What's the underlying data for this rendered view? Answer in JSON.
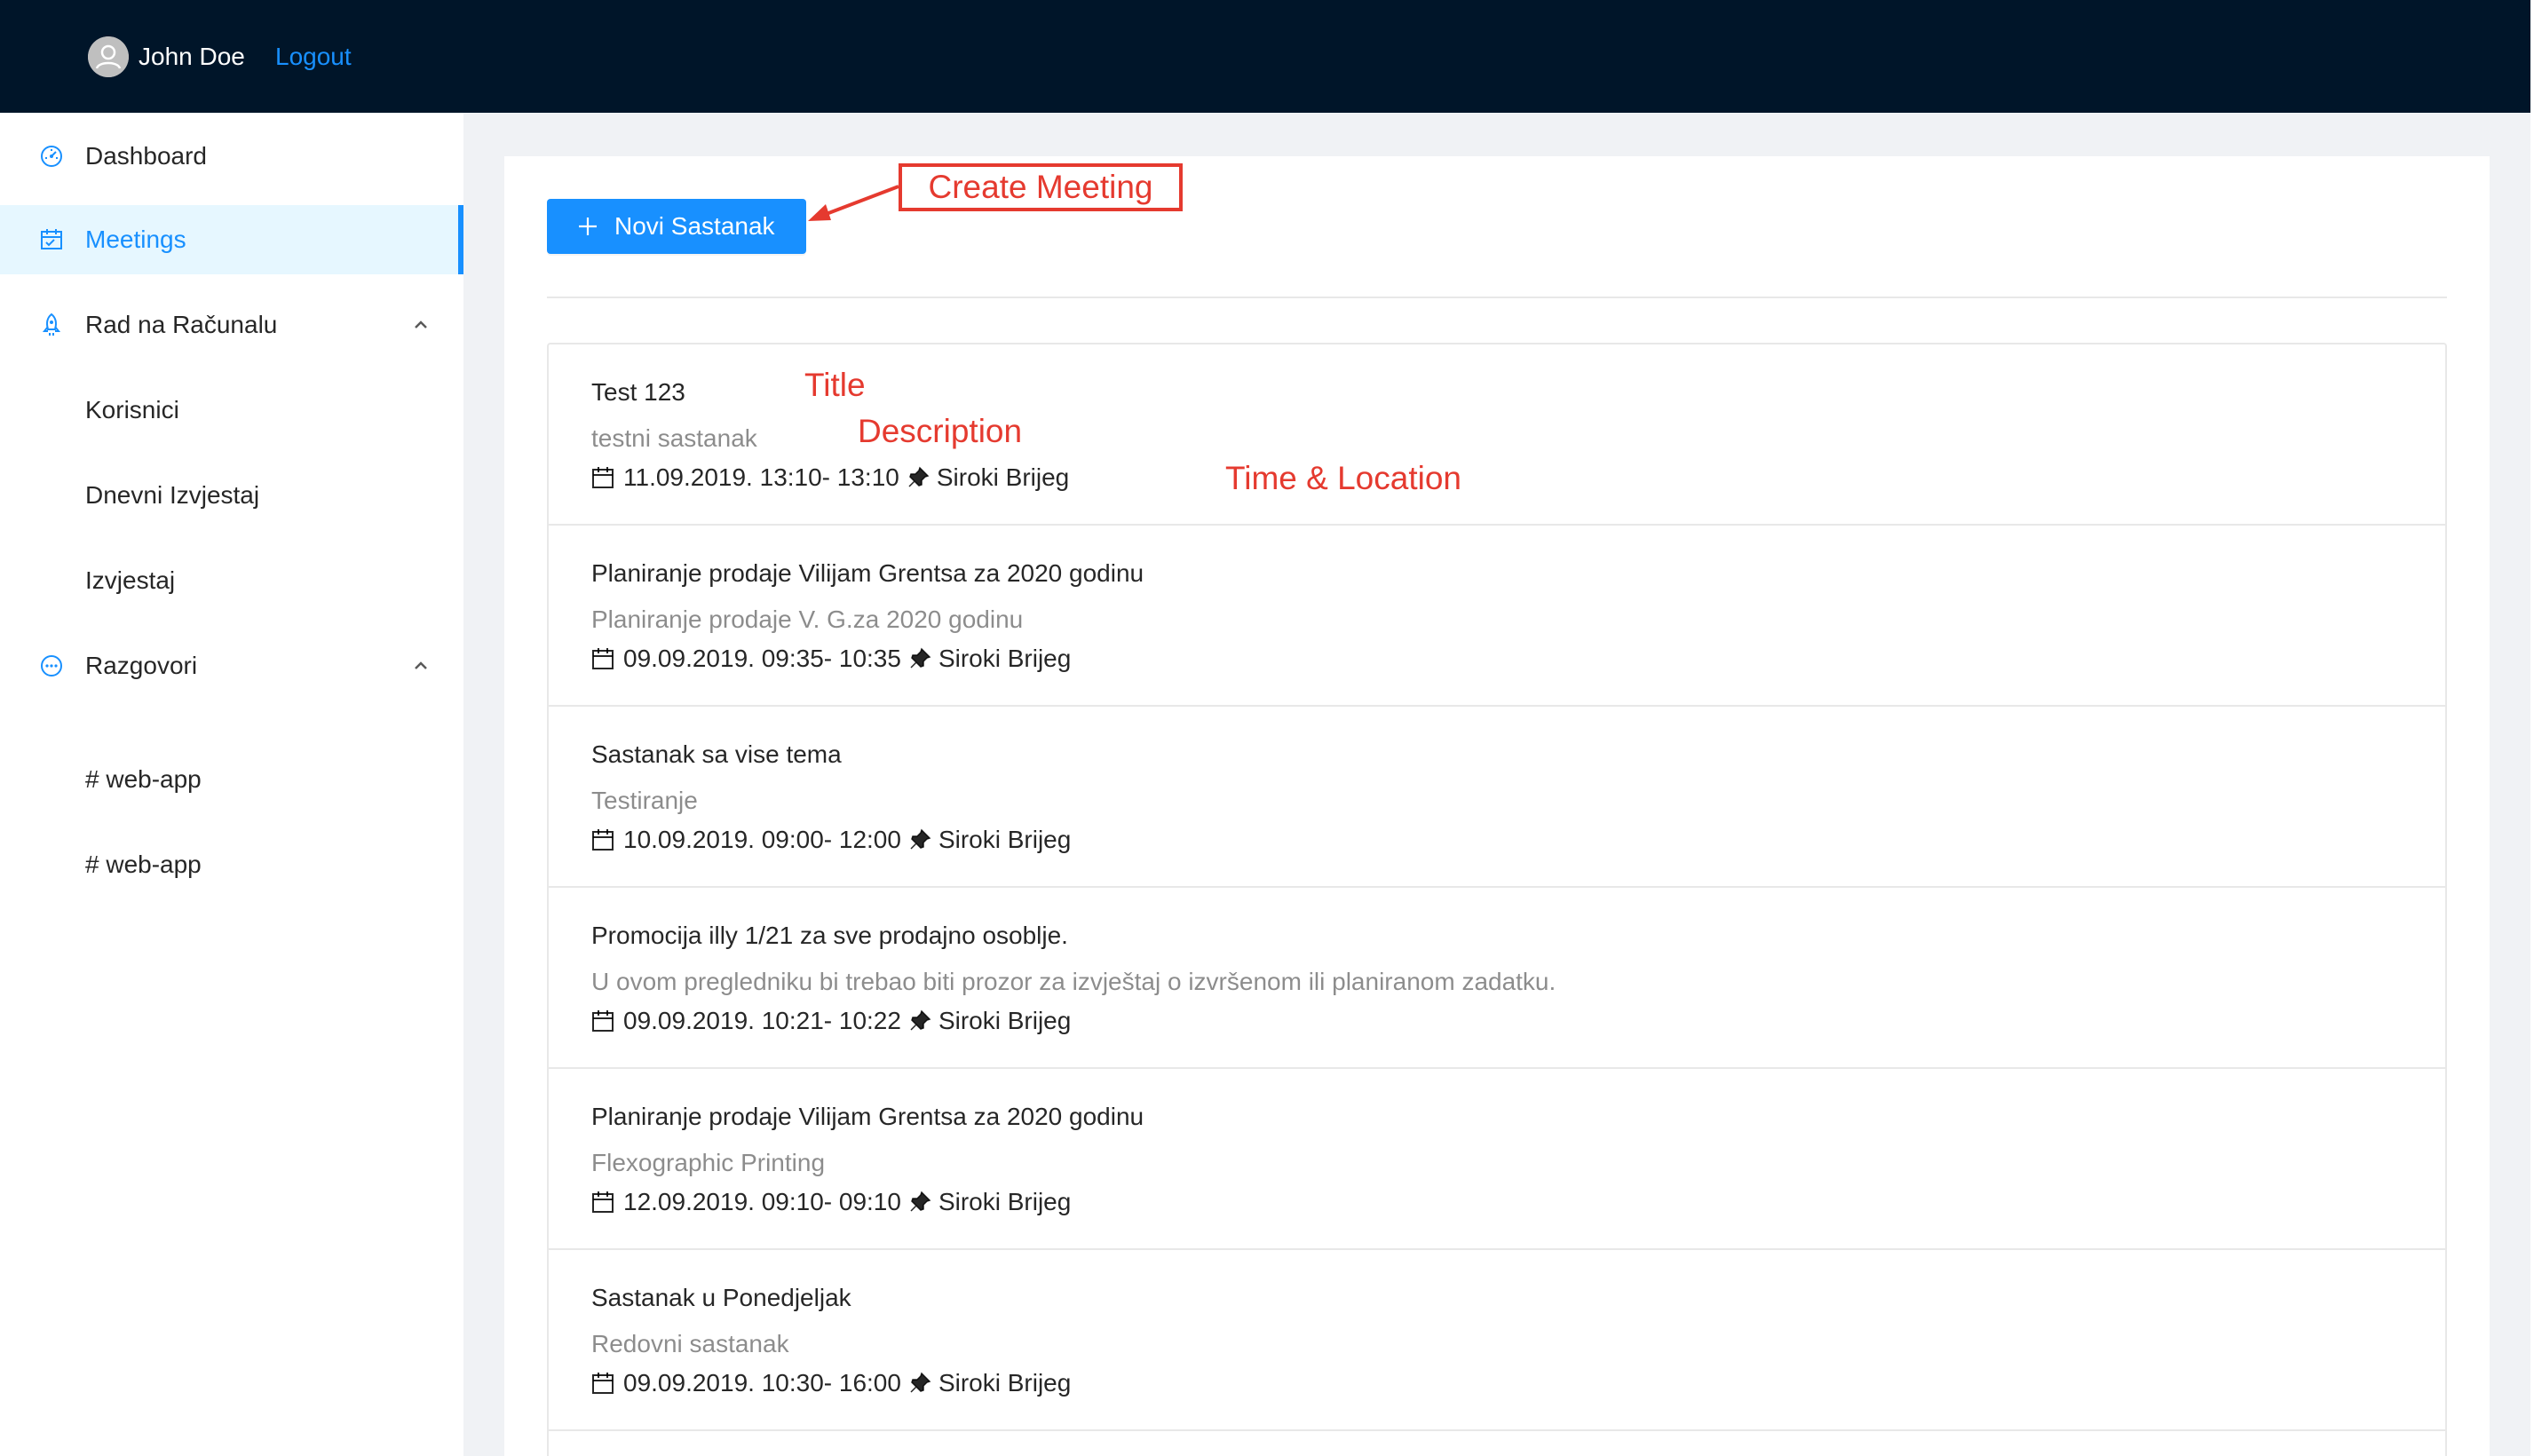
{
  "header": {
    "user_name": "John Doe",
    "logout_label": "Logout",
    "background": "#001529",
    "link_color": "#1890ff"
  },
  "sidebar": {
    "items": [
      {
        "label": "Dashboard",
        "icon": "dashboard-icon"
      },
      {
        "label": "Meetings",
        "icon": "calendar-icon",
        "selected": true
      },
      {
        "label": "Rad na Računalu",
        "icon": "rocket-icon",
        "expanded": true
      },
      {
        "label": "Korisnici"
      },
      {
        "label": "Dnevni Izvjestaj"
      },
      {
        "label": "Izvjestaj"
      },
      {
        "label": "Razgovori",
        "icon": "message-icon",
        "expanded": true
      },
      {
        "label": "# web-app"
      },
      {
        "label": "# web-app"
      }
    ],
    "accent": "#1890ff"
  },
  "toolbar": {
    "new_meeting_label": "Novi Sastanak"
  },
  "meetings": [
    {
      "title": "Test 123",
      "description": "testni sastanak",
      "time": "11.09.2019. 13:10- 13:10",
      "location": "Siroki Brijeg"
    },
    {
      "title": "Planiranje prodaje Vilijam Grentsa za 2020 godinu",
      "description": "Planiranje prodaje V. G.za 2020 godinu",
      "time": "09.09.2019. 09:35- 10:35",
      "location": "Siroki Brijeg"
    },
    {
      "title": "Sastanak sa vise tema",
      "description": "Testiranje",
      "time": "10.09.2019. 09:00- 12:00",
      "location": "Siroki Brijeg"
    },
    {
      "title": "Promocija illy 1/21 za sve prodajno osoblje.",
      "description": "U ovom pregledniku bi trebao biti prozor za izvještaj o izvršenom ili planiranom zadatku.",
      "time": "09.09.2019. 10:21- 10:22",
      "location": "Siroki Brijeg"
    },
    {
      "title": "Planiranje prodaje Vilijam Grentsa za 2020 godinu",
      "description": "Flexographic Printing",
      "time": "12.09.2019. 09:10- 09:10",
      "location": "Siroki Brijeg"
    },
    {
      "title": "Sastanak u Ponedjeljak",
      "description": "Redovni sastanak",
      "time": "09.09.2019. 10:30- 16:00",
      "location": "Siroki Brijeg"
    }
  ],
  "annotations": {
    "create_meeting": "Create Meeting",
    "title": "Title",
    "description": "Description",
    "time_location": "Time & Location",
    "color": "#e53a2f"
  }
}
